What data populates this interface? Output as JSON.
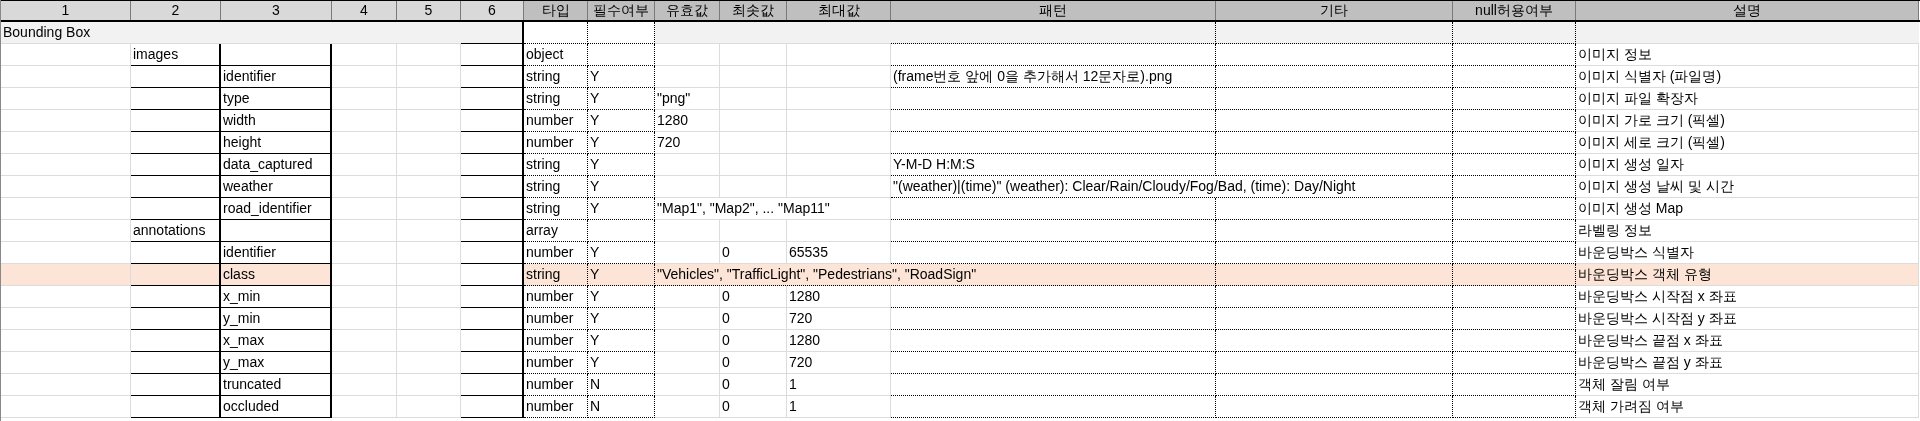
{
  "columns": [
    "1",
    "2",
    "3",
    "4",
    "5",
    "6",
    "타입",
    "필수여부",
    "유효값",
    "최솟값",
    "최대값",
    "패턴",
    "기타",
    "null허용여부",
    "설명"
  ],
  "rows": [
    {
      "kind": "section",
      "highlighted": false,
      "name": "Bounding Box"
    },
    {
      "kind": "group",
      "highlighted": false,
      "name": "images",
      "type": "object",
      "description": "이미지 정보"
    },
    {
      "kind": "field",
      "highlighted": false,
      "name": "identifier",
      "type": "string",
      "required": "Y",
      "pattern": "(frame번호 앞에 0을 추가해서 12문자로).png",
      "description": "이미지 식별자 (파일명)"
    },
    {
      "kind": "field",
      "highlighted": false,
      "name": "type",
      "type": "string",
      "required": "Y",
      "valid_values": "\"png\"",
      "description": "이미지 파일 확장자"
    },
    {
      "kind": "field",
      "highlighted": false,
      "name": "width",
      "type": "number",
      "required": "Y",
      "valid_values": "1280",
      "description": "이미지 가로 크기 (픽셀)"
    },
    {
      "kind": "field",
      "highlighted": false,
      "name": "height",
      "type": "number",
      "required": "Y",
      "valid_values": "720",
      "description": "이미지 세로 크기 (픽셀)"
    },
    {
      "kind": "field",
      "highlighted": false,
      "name": "data_captured",
      "type": "string",
      "required": "Y",
      "pattern": "Y-M-D H:M:S",
      "description": "이미지 생성 일자"
    },
    {
      "kind": "field",
      "highlighted": false,
      "name": "weather",
      "type": "string",
      "required": "Y",
      "pattern": "\"(weather)|(time)\"   (weather): Clear/Rain/Cloudy/Fog/Bad, (time): Day/Night",
      "description": "이미지 생성 날씨 및 시간"
    },
    {
      "kind": "field",
      "highlighted": false,
      "name": "road_identifier",
      "type": "string",
      "required": "Y",
      "valid_values": "\"Map1\", \"Map2\", ... \"Map11\"",
      "description": "이미지 생성 Map"
    },
    {
      "kind": "group",
      "highlighted": false,
      "name": "annotations",
      "type": "array",
      "description": "라벨링 정보"
    },
    {
      "kind": "field",
      "highlighted": false,
      "name": "identifier",
      "type": "number",
      "required": "Y",
      "min": "0",
      "max": "65535",
      "description": "바운딩박스 식별자"
    },
    {
      "kind": "field",
      "highlighted": true,
      "name": "class",
      "type": "string",
      "required": "Y",
      "valid_values": "\"Vehicles\", \"TrafficLight\", \"Pedestrians\", \"RoadSign\"",
      "description": "바운딩박스 객체 유형"
    },
    {
      "kind": "field",
      "highlighted": false,
      "name": "x_min",
      "type": "number",
      "required": "Y",
      "min": "0",
      "max": "1280",
      "description": "바운딩박스 시작점 x 좌표"
    },
    {
      "kind": "field",
      "highlighted": false,
      "name": "y_min",
      "type": "number",
      "required": "Y",
      "min": "0",
      "max": "720",
      "description": "바운딩박스 시작점 y 좌표"
    },
    {
      "kind": "field",
      "highlighted": false,
      "name": "x_max",
      "type": "number",
      "required": "Y",
      "min": "0",
      "max": "1280",
      "description": "바운딩박스 끝점 x 좌표"
    },
    {
      "kind": "field",
      "highlighted": false,
      "name": "y_max",
      "type": "number",
      "required": "Y",
      "min": "0",
      "max": "720",
      "description": "바운딩박스 끝점 y 좌표"
    },
    {
      "kind": "field",
      "highlighted": false,
      "name": "truncated",
      "type": "number",
      "required": "N",
      "min": "0",
      "max": "1",
      "description": "객체 잘림 여부"
    },
    {
      "kind": "field",
      "highlighted": false,
      "name": "occluded",
      "type": "number",
      "required": "N",
      "min": "0",
      "max": "1",
      "description": "객체 가려짐 여부"
    }
  ]
}
